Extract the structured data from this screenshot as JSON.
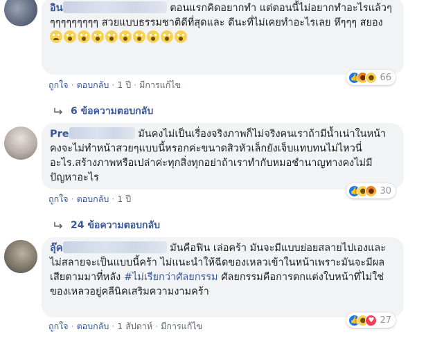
{
  "comments": [
    {
      "name_visible": "อิน",
      "text_before": "ตอนแรกคิดอยากทำ แต่ตอนนี้ไม่อยากทำอะไรแล้วๆๆๆๆๆๆๆๆๆๆ สวยแบบธรรมชาติดีที่สุดและ ดีนะที่ไม่เคยทำอะไรเลย หึๆๆๆ สยอง",
      "emoji_count": 10,
      "reaction_count": "66",
      "like_label": "ถูกใจ",
      "reply_label": "ตอบกลับ",
      "time": "1 ปี",
      "edited": "มีการแก้ไข",
      "replies_label": "6 ข้อความตอบกลับ"
    },
    {
      "name_visible": "Pre",
      "text_before": "มันคงไม่เป็นเรื่องจริงภาพก็ไม่จริงคนเราถ้ามีน้ำเน่าในหน้าคงจะไม่ทำหน้าสวยๆแบบนี้หรอกค่ะขนาดสิวหัวเล็กยังเจ็บแทบทนไม่ไหวนี่อะไร.สร้างภาพหรือเปล่าค่ะทุกสิ่งทุกอย่าถ้าเราทำกับหมอชำนาญทางคงไม่มีปัญหาอะไร",
      "reaction_count": "30",
      "like_label": "ถูกใจ",
      "reply_label": "ตอบกลับ",
      "time": "1 ปี",
      "replies_label": "24 ข้อความตอบกลับ"
    },
    {
      "name_visible": "ลุ๊ค",
      "text_before": "มันคือฟิน เล่อคร้า มันจะมีแบบย่อยสลายไปเองและไม่สลายจะเป็นแบบนี้คร้า ไม่แนะนำให้ฉีดของเหลวเข้าในหน้าเพราะมันจะมีผลเสียตามมาที่หลัง",
      "hashtag": "#ไม่เรียกว่าศัลยกรรม",
      "text_after": "ศัลยกรรมคือการตกแต่งใบหน้าที่ไม่ใช่ของเหลวอยู่คลีนิคเสริมความงามคร้า",
      "reaction_count": "27",
      "like_label": "ถูกใจ",
      "reply_label": "ตอบกลับ",
      "time": "1 สัปดาห์",
      "edited": "มีการแก้ไข"
    }
  ],
  "colors": {
    "link": "#385898",
    "bubble": "#f2f3f5",
    "meta": "#606770"
  }
}
